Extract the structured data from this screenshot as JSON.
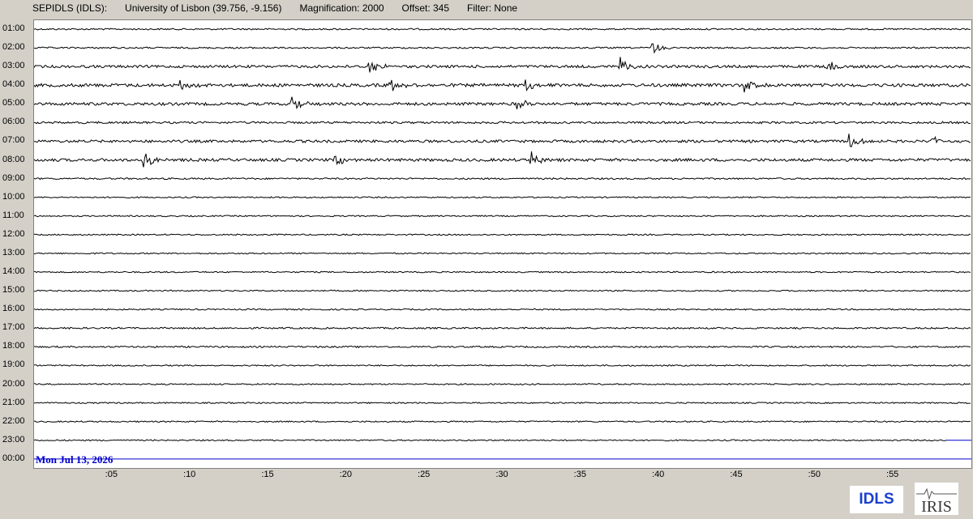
{
  "header": {
    "station": "SEPIDLS (IDLS):",
    "location": "University of Lisbon (39.756, -9.156)",
    "magnification": "Magnification: 2000",
    "offset": "Offset: 345",
    "filter": "Filter: None"
  },
  "date_label": "Mon Jul 13, 2026",
  "logos": {
    "idls": "IDLS",
    "iris": "IRIS"
  },
  "chart_data": {
    "type": "line",
    "title": "",
    "hours": [
      "01:00",
      "02:00",
      "03:00",
      "04:00",
      "05:00",
      "06:00",
      "07:00",
      "08:00",
      "09:00",
      "10:00",
      "11:00",
      "12:00",
      "13:00",
      "14:00",
      "15:00",
      "16:00",
      "17:00",
      "18:00",
      "19:00",
      "20:00",
      "21:00",
      "22:00",
      "23:00",
      "00:00"
    ],
    "x_ticks": [
      ":05",
      ":10",
      ":15",
      ":20",
      ":25",
      ":30",
      ":35",
      ":40",
      ":45",
      ":50",
      ":55"
    ],
    "x_range_minutes": [
      0,
      60
    ],
    "trace_noise_level": [
      0.6,
      0.6,
      1.0,
      1.2,
      1.1,
      0.8,
      1.0,
      1.1,
      0.6,
      0.5,
      0.5,
      0.5,
      0.5,
      0.5,
      0.5,
      0.5,
      0.6,
      0.6,
      0.5,
      0.5,
      0.5,
      0.5,
      0.5,
      0
    ],
    "events": [
      {
        "hour": "02:00",
        "minute": 39.5,
        "amplitude": 8
      },
      {
        "hour": "03:00",
        "minute": 21.5,
        "amplitude": 9
      },
      {
        "hour": "03:00",
        "minute": 37.5,
        "amplitude": 12
      },
      {
        "hour": "03:00",
        "minute": 50.8,
        "amplitude": 8
      },
      {
        "hour": "04:00",
        "minute": 9.3,
        "amplitude": 8
      },
      {
        "hour": "04:00",
        "minute": 22.8,
        "amplitude": 10
      },
      {
        "hour": "04:00",
        "minute": 31.5,
        "amplitude": 10
      },
      {
        "hour": "04:00",
        "minute": 45.5,
        "amplitude": 9
      },
      {
        "hour": "05:00",
        "minute": 16.5,
        "amplitude": 10
      },
      {
        "hour": "05:00",
        "minute": 31,
        "amplitude": 8
      },
      {
        "hour": "07:00",
        "minute": 52.2,
        "amplitude": 10
      },
      {
        "hour": "07:00",
        "minute": 57.5,
        "amplitude": 8
      },
      {
        "hour": "08:00",
        "minute": 7,
        "amplitude": 10
      },
      {
        "hour": "08:00",
        "minute": 19.3,
        "amplitude": 9
      },
      {
        "hour": "08:00",
        "minute": 31.8,
        "amplitude": 12
      }
    ],
    "trace_color": "#000000",
    "current_time_line_color": "#0000cc",
    "grid": false
  }
}
